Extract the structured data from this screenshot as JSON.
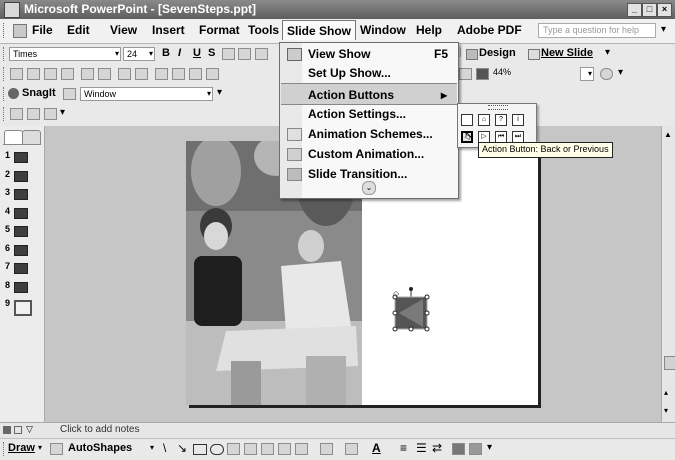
{
  "window": {
    "title": "Microsoft PowerPoint - [SevenSteps.ppt]"
  },
  "menubar": {
    "items": [
      "File",
      "Edit",
      "View",
      "Insert",
      "Format",
      "Tools",
      "Slide Show",
      "Window",
      "Help",
      "Adobe PDF"
    ],
    "ask_placeholder": "Type a question for help"
  },
  "format_toolbar": {
    "font": "Times",
    "size": "24",
    "bold": "B",
    "italic": "I",
    "underline": "U",
    "shadow": "S",
    "design_label": "Design",
    "new_slide_label": "New Slide",
    "zoom": "44%"
  },
  "snagit_toolbar": {
    "label": "SnagIt",
    "mode": "Window"
  },
  "slideshow_menu": {
    "items": [
      {
        "label": "View Show",
        "shortcut": "F5"
      },
      {
        "label": "Set Up Show...",
        "shortcut": ""
      },
      {
        "label": "Action Buttons",
        "shortcut": "▸"
      },
      {
        "label": "Action Settings...",
        "shortcut": ""
      },
      {
        "label": "Animation Schemes...",
        "shortcut": ""
      },
      {
        "label": "Custom Animation...",
        "shortcut": ""
      },
      {
        "label": "Slide Transition...",
        "shortcut": ""
      }
    ],
    "expand": "⌄"
  },
  "action_palette": {
    "tooltip": "Action Button: Back or Previous"
  },
  "slides": {
    "numbers": [
      "1",
      "2",
      "3",
      "4",
      "5",
      "6",
      "7",
      "8",
      "9"
    ]
  },
  "notes": {
    "placeholder": "Click to add notes"
  },
  "draw_toolbar": {
    "draw_label": "Draw",
    "autoshapes_label": "AutoShapes"
  }
}
